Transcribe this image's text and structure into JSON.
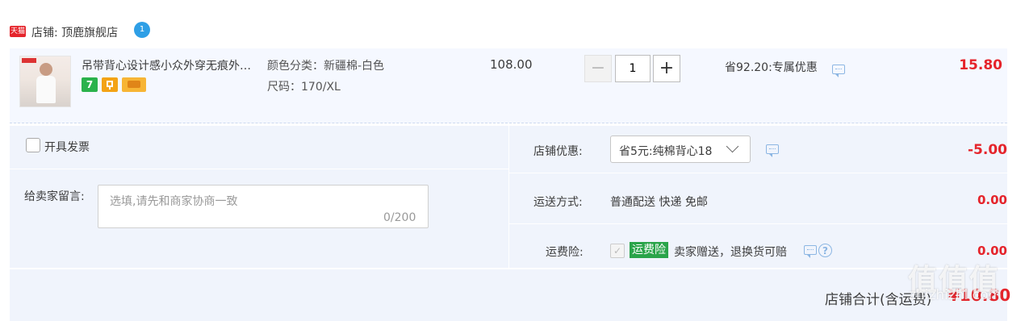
{
  "shop": {
    "badge": "天猫",
    "label": "店铺: 顶鹿旗舰店",
    "chat_badge": "1"
  },
  "item": {
    "title": "吊带背心设计感小众外穿无痕外…",
    "service_badges": [
      "7",
      "",
      ""
    ],
    "sku_color": "颜色分类：新疆棉-白色",
    "sku_size": "尺码：170/XL",
    "unit_price": "108.00",
    "quantity": {
      "minus": "−",
      "value": "1",
      "plus": "+"
    },
    "discount_text": "省92.20:专属优惠",
    "subtotal": "15.80"
  },
  "invoice": {
    "label": "开具发票",
    "checked": false
  },
  "message": {
    "label": "给卖家留言:",
    "placeholder": "选填,请先和商家协商一致",
    "counter": "0/200"
  },
  "shop_coupon": {
    "label": "店铺优惠:",
    "selected": "省5元:纯棉背心18",
    "amount": "-5.00"
  },
  "shipping": {
    "label": "运送方式:",
    "value": "普通配送 快递 免邮",
    "amount": "0.00"
  },
  "insurance": {
    "label": "运费险:",
    "badge": "运费险",
    "text": "卖家赠送，退换货可赔",
    "amount": "0.00",
    "checked": true
  },
  "summary": {
    "label": "店铺合计(含运费)",
    "amount": "¥10.80"
  },
  "watermark": {
    "main": "值值值",
    "sub": "zhizhizhi.com"
  },
  "colors": {
    "accent_red": "#e5242b",
    "panel_bg": "#f0f4fc",
    "insurance_green": "#2aa44a"
  }
}
